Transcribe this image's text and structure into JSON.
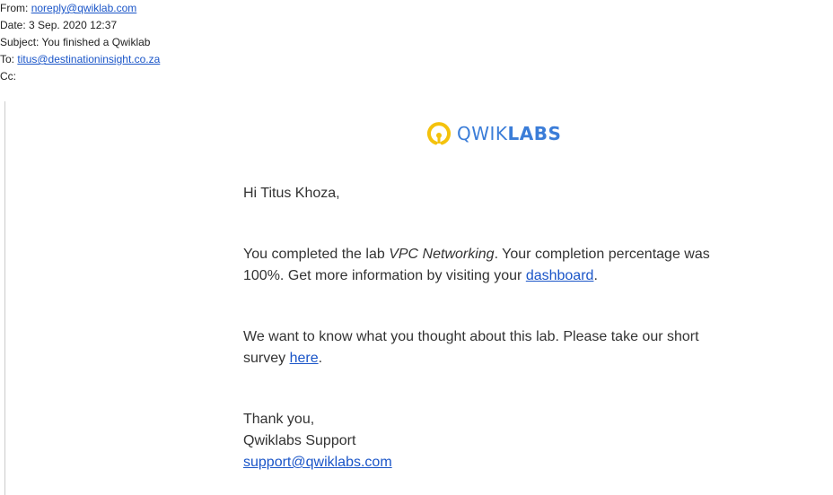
{
  "headers": {
    "from_label": "From:",
    "from": "noreply@qwiklab.com",
    "date_label": "Date:",
    "date": "3 Sep. 2020 12:37",
    "subject_label": "Subject:",
    "subject": "You finished a Qwiklab",
    "to_label": "To:",
    "to": "titus@destinationinsight.co.za",
    "cc_label": "Cc:"
  },
  "logo": {
    "light": "QWIK",
    "bold": "LABS",
    "brand_color": "#3b7dd8",
    "icon_color": "#f4c20d"
  },
  "message": {
    "greeting": "Hi Titus Khoza,",
    "completed_pre": "You completed the lab ",
    "lab_name": "VPC Networking",
    "completed_mid": ". Your completion percentage was 100%. Get more information by visiting your ",
    "dashboard_link": "dashboard",
    "completed_end": ".",
    "survey_pre": "We want to know what you thought about this lab. Please take our short survey ",
    "survey_link": "here",
    "survey_end": ".",
    "thanks": "Thank you,",
    "signature": "Qwiklabs Support",
    "support_email": "support@qwiklabs.com"
  }
}
